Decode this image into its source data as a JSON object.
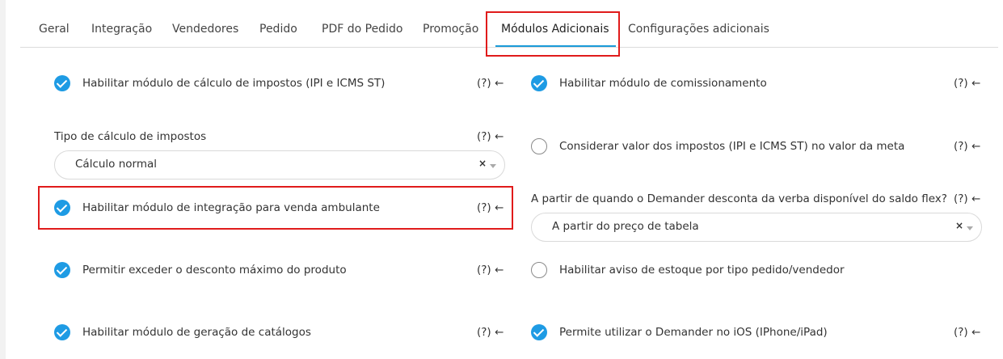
{
  "tabs": [
    {
      "label": "Geral"
    },
    {
      "label": "Integração"
    },
    {
      "label": "Vendedores"
    },
    {
      "label": "Pedido"
    },
    {
      "label": "PDF do Pedido"
    },
    {
      "label": "Promoção"
    },
    {
      "label": "Módulos Adicionais"
    },
    {
      "label": "Configurações adicionais"
    }
  ],
  "active_tab": "Módulos Adicionais",
  "help_text": "(?) ←",
  "left": {
    "impostos": {
      "label": "Habilitar módulo de cálculo de impostos (IPI e ICMS ST)",
      "checked": true
    },
    "tipo_calculo": {
      "label": "Tipo de cálculo de impostos",
      "value": "Cálculo normal",
      "clear": "×"
    },
    "venda_ambulante": {
      "label": "Habilitar módulo de integração para venda ambulante",
      "checked": true
    },
    "desconto_maximo": {
      "label": "Permitir exceder o desconto máximo do produto",
      "checked": true
    },
    "catalogos": {
      "label": "Habilitar módulo de geração de catálogos",
      "checked": true
    }
  },
  "right": {
    "comissionamento": {
      "label": "Habilitar módulo de comissionamento",
      "checked": true
    },
    "valor_impostos_meta": {
      "label": "Considerar valor dos impostos (IPI e ICMS ST) no valor da meta",
      "checked": false
    },
    "verba_flex": {
      "label": "A partir de quando o Demander desconta da verba disponível do saldo flex?",
      "value": "A partir do preço de tabela",
      "clear": "×"
    },
    "aviso_estoque": {
      "label": "Habilitar aviso de estoque por tipo pedido/vendedor",
      "checked": false
    },
    "ios": {
      "label": "Permite utilizar o Demander no iOS (IPhone/iPad)",
      "checked": true
    }
  },
  "colors": {
    "accent": "#1e9be4",
    "highlight": "#e01b1b",
    "tab_underline": "#1a9bd8"
  }
}
